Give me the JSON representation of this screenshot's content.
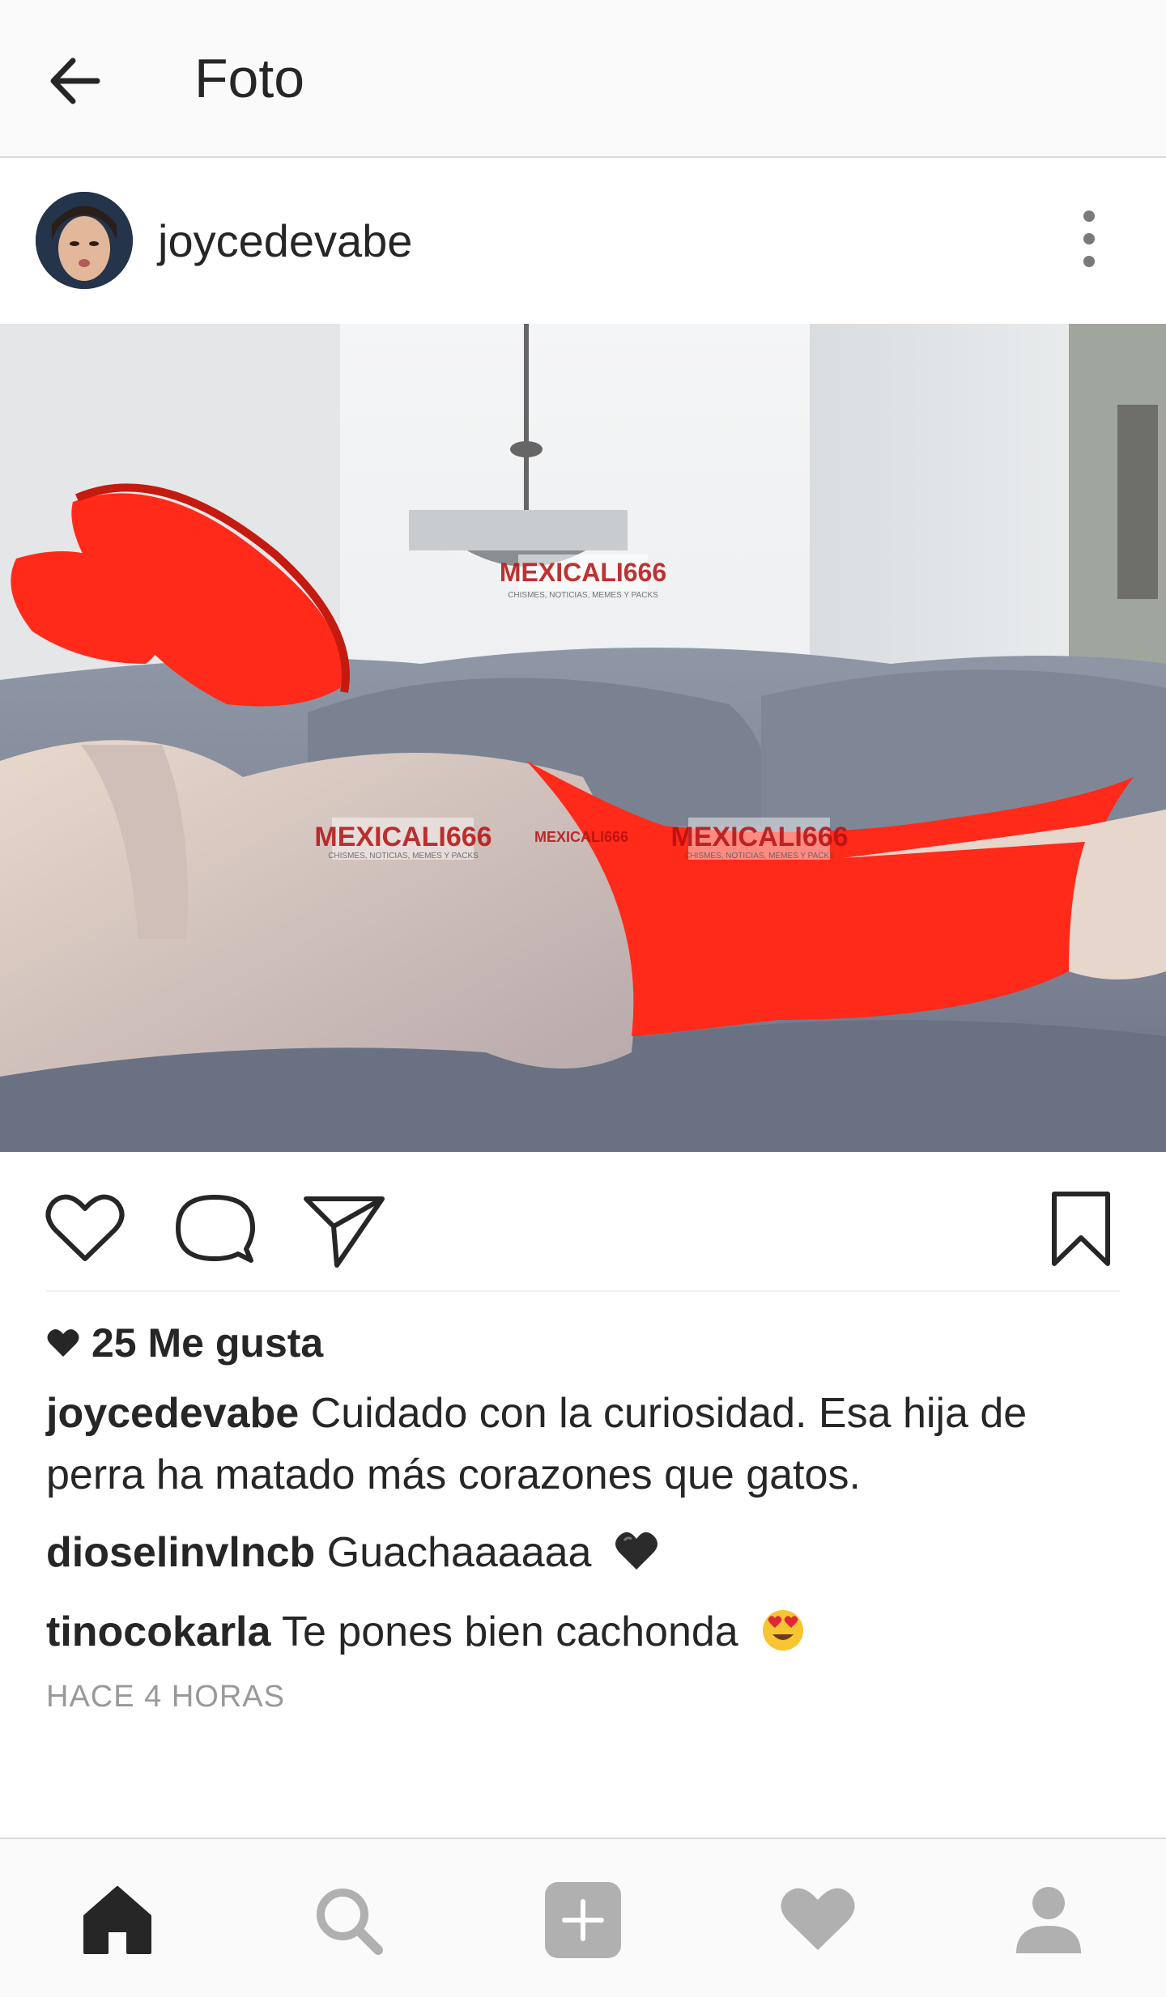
{
  "header": {
    "title": "Foto"
  },
  "post": {
    "username": "joycedevabe",
    "watermark": "MEXICALI666",
    "watermark_sub": "CHISMES, NOTICIAS, MEMES Y PACKS",
    "likes_text": "25 Me gusta",
    "caption_user": "joycedevabe",
    "caption_text": "Cuidado con la curiosidad. Esa hija de perra ha matado más corazones que gatos.",
    "comments": [
      {
        "user": "dioselinvlncb",
        "text": "Guachaaaaaa",
        "emoji": "black-heart"
      },
      {
        "user": "tinocokarla",
        "text": "Te pones bien cachonda",
        "emoji": "heart-eyes"
      }
    ],
    "time": "HACE 4 HORAS"
  },
  "colors": {
    "accent": "#262626",
    "muted": "#999999",
    "red": "#ff2a1a"
  },
  "icons": {
    "back": "arrow-left-icon",
    "more": "more-vertical-icon",
    "like": "heart-outline-icon",
    "comment": "comment-icon",
    "share": "send-icon",
    "save": "bookmark-icon",
    "home": "home-icon",
    "search": "search-icon",
    "add": "add-icon",
    "activity": "heart-icon",
    "profile": "profile-icon"
  }
}
